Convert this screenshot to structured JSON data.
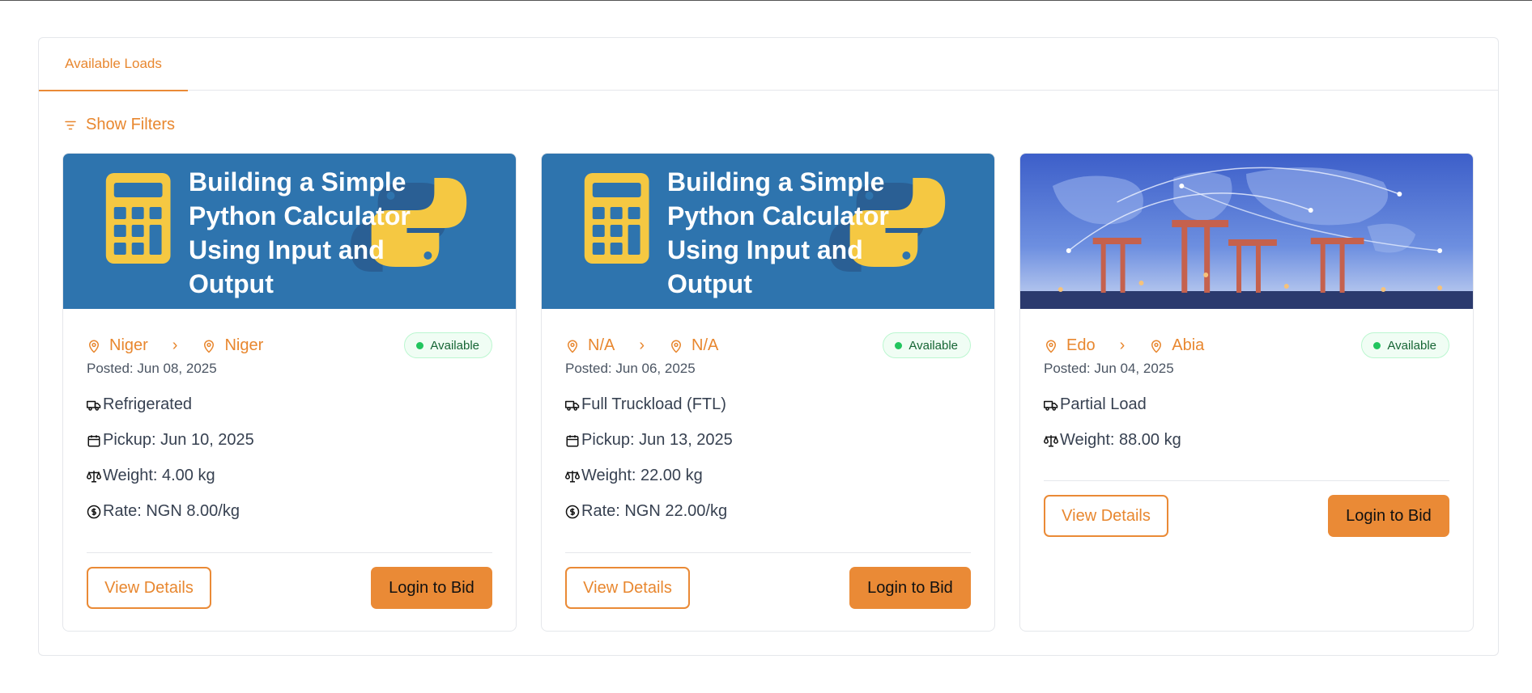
{
  "tabs": [
    {
      "label": "Available Loads",
      "active": true
    }
  ],
  "filters": {
    "label": "Show Filters"
  },
  "accent_color": "#ea8a36",
  "cards": [
    {
      "image": "python-calculator-thumbnail",
      "image_caption": "Building a Simple Python Calculator Using Input and Output",
      "origin": "Niger",
      "destination": "Niger",
      "status": "Available",
      "posted": "Posted: Jun 08, 2025",
      "load_type": "Refrigerated",
      "pickup": "Pickup: Jun 10, 2025",
      "weight": "Weight: 4.00 kg",
      "rate": "Rate: NGN 8.00/kg",
      "view_label": "View Details",
      "bid_label": "Login to Bid"
    },
    {
      "image": "python-calculator-thumbnail",
      "image_caption": "Building a Simple Python Calculator Using Input and Output",
      "origin": "N/A",
      "destination": "N/A",
      "status": "Available",
      "posted": "Posted: Jun 06, 2025",
      "load_type": "Full Truckload (FTL)",
      "pickup": "Pickup: Jun 13, 2025",
      "weight": "Weight: 22.00 kg",
      "rate": "Rate: NGN 22.00/kg",
      "view_label": "View Details",
      "bid_label": "Login to Bid"
    },
    {
      "image": "port-cranes-world-map-photo",
      "origin": "Edo",
      "destination": "Abia",
      "status": "Available",
      "posted": "Posted: Jun 04, 2025",
      "load_type": "Partial Load",
      "weight": "Weight: 88.00 kg",
      "view_label": "View Details",
      "bid_label": "Login to Bid"
    }
  ]
}
